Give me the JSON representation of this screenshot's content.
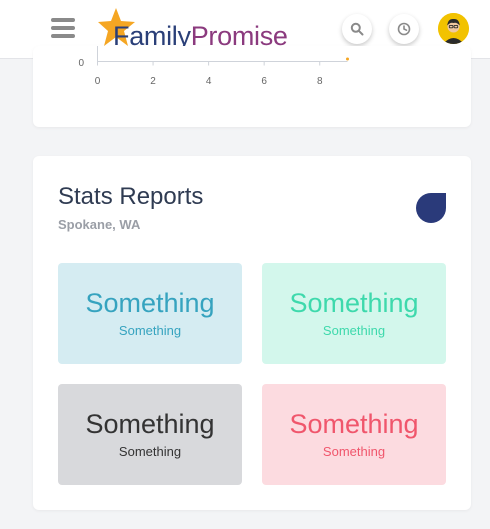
{
  "header": {
    "brand": {
      "part1": "Family",
      "part2": "Promise"
    }
  },
  "chart_data": {
    "type": "line",
    "xlim": [
      0,
      9
    ],
    "x_ticks": [
      "0",
      "2",
      "4",
      "6",
      "8"
    ],
    "y_ticks": [
      "0"
    ],
    "series": []
  },
  "stats": {
    "title": "Stats Reports",
    "location": "Spokane, WA",
    "tiles": [
      {
        "big": "Something",
        "small": "Something",
        "bg": "#d5ecf2",
        "color": "#36a3bf"
      },
      {
        "big": "Something",
        "small": "Something",
        "bg": "#d3f7ec",
        "color": "#3ed9ac"
      },
      {
        "big": "Something",
        "small": "Something",
        "bg": "#d8d9dc",
        "color": "#333333"
      },
      {
        "big": "Something",
        "small": "Something",
        "bg": "#fcdbe0",
        "color": "#f0566c"
      }
    ]
  },
  "colors": {
    "brand_navy": "#2a3f78",
    "brand_purple": "#8b3a7e",
    "star": "#f5a623",
    "accent_shape": "#2a3a7a"
  },
  "icons": {
    "menu": "hamburger-menu-icon",
    "search": "search-icon",
    "history": "clock-icon",
    "avatar": "user-avatar"
  }
}
